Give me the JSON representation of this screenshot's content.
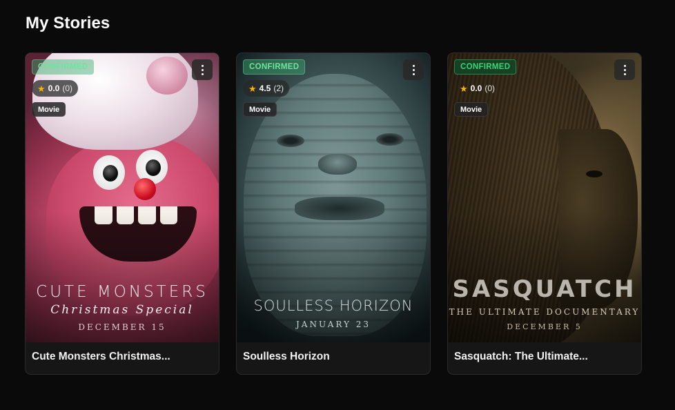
{
  "page": {
    "title": "My Stories"
  },
  "stories": [
    {
      "title": "Cute Monsters Christmas...",
      "status": "CONFIRMED",
      "rating": "0.0",
      "rating_count": "(0)",
      "genre": "Movie",
      "poster": {
        "title": "CUTE MONSTERS",
        "subtitle": "Christmas Special",
        "date": "DECEMBER 15"
      },
      "icons": {
        "rating": "star-icon",
        "menu": "kebab-menu-icon"
      }
    },
    {
      "title": "Soulless Horizon",
      "status": "CONFIRMED",
      "rating": "4.5",
      "rating_count": "(2)",
      "genre": "Movie",
      "poster": {
        "title": "SOULLESS HORIZON",
        "date": "JANUARY 23"
      },
      "icons": {
        "rating": "star-icon",
        "menu": "kebab-menu-icon"
      }
    },
    {
      "title": "Sasquatch: The Ultimate...",
      "status": "CONFIRMED",
      "rating": "0.0",
      "rating_count": "(0)",
      "genre": "Movie",
      "poster": {
        "title": "SASQUATCH",
        "subtitle": "THE ULTIMATE DOCUMENTARY",
        "date": "DECEMBER 5"
      },
      "icons": {
        "rating": "star-icon",
        "menu": "kebab-menu-icon"
      }
    }
  ],
  "colors": {
    "background": "#0a0a0a",
    "card": "#161616",
    "status_green": "#37d67a",
    "star": "#f7b500"
  }
}
